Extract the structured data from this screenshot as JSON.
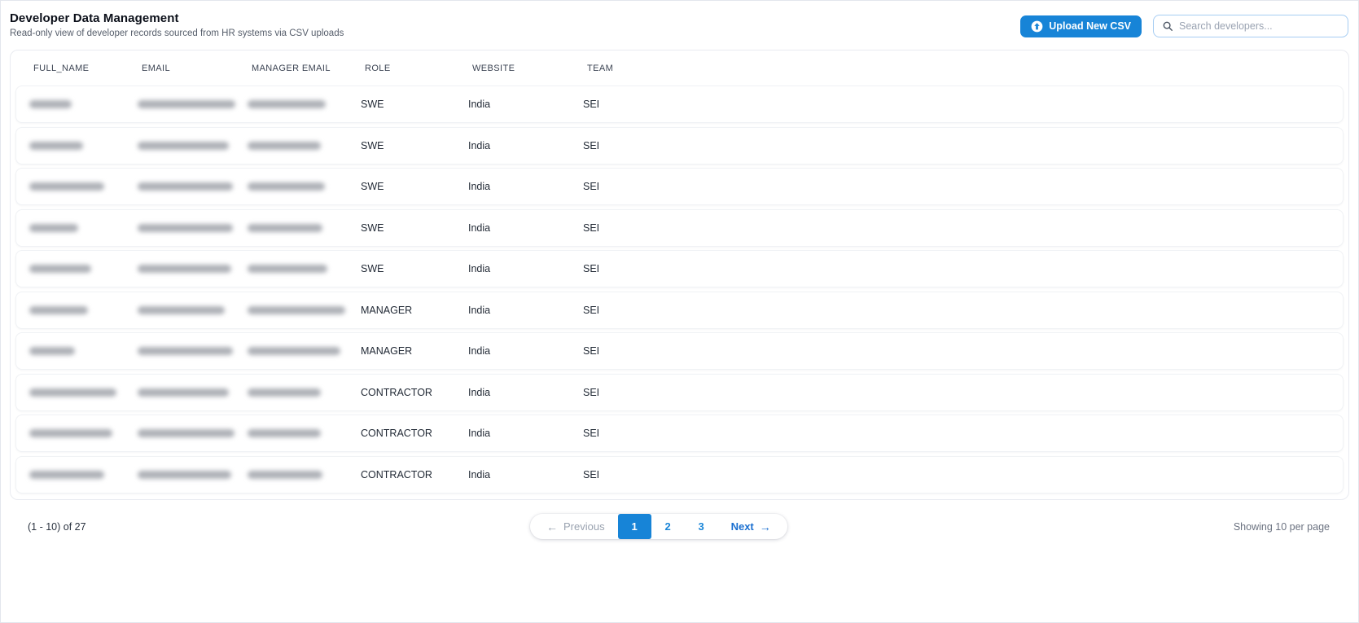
{
  "page": {
    "title": "Developer Data Management",
    "subtitle": "Read-only view of developer records sourced from HR systems via CSV uploads"
  },
  "toolbar": {
    "upload_button_label": "Upload New CSV",
    "upload_icon": "arrow-up-circle",
    "search_icon": "magnifier",
    "search_placeholder": "Search developers...",
    "search_value": ""
  },
  "colors": {
    "accent_blue": "#1784d7",
    "search_border_blue": "#a6cdf3",
    "disabled_gray": "#9aa3b0"
  },
  "table": {
    "columns": [
      "FULL_NAME",
      "EMAIL",
      "MANAGER EMAIL",
      "ROLE",
      "WEBSITE",
      "TEAM"
    ],
    "redacted_columns": [
      "FULL_NAME",
      "EMAIL",
      "MANAGER EMAIL"
    ],
    "rows": [
      {
        "full_name_redacted": true,
        "email_redacted": true,
        "manager_email_redacted": true,
        "role": "SWE",
        "website": "India",
        "team": "SEI"
      },
      {
        "full_name_redacted": true,
        "email_redacted": true,
        "manager_email_redacted": true,
        "role": "SWE",
        "website": "India",
        "team": "SEI"
      },
      {
        "full_name_redacted": true,
        "email_redacted": true,
        "manager_email_redacted": true,
        "role": "SWE",
        "website": "India",
        "team": "SEI"
      },
      {
        "full_name_redacted": true,
        "email_redacted": true,
        "manager_email_redacted": true,
        "role": "SWE",
        "website": "India",
        "team": "SEI"
      },
      {
        "full_name_redacted": true,
        "email_redacted": true,
        "manager_email_redacted": true,
        "role": "SWE",
        "website": "India",
        "team": "SEI"
      },
      {
        "full_name_redacted": true,
        "email_redacted": true,
        "manager_email_redacted": true,
        "role": "MANAGER",
        "website": "India",
        "team": "SEI"
      },
      {
        "full_name_redacted": true,
        "email_redacted": true,
        "manager_email_redacted": true,
        "role": "MANAGER",
        "website": "India",
        "team": "SEI"
      },
      {
        "full_name_redacted": true,
        "email_redacted": true,
        "manager_email_redacted": true,
        "role": "CONTRACTOR",
        "website": "India",
        "team": "SEI"
      },
      {
        "full_name_redacted": true,
        "email_redacted": true,
        "manager_email_redacted": true,
        "role": "CONTRACTOR",
        "website": "India",
        "team": "SEI"
      },
      {
        "full_name_redacted": true,
        "email_redacted": true,
        "manager_email_redacted": true,
        "role": "CONTRACTOR",
        "website": "India",
        "team": "SEI"
      }
    ]
  },
  "pagination": {
    "range_label": "(1 - 10) of 27",
    "previous_label": "Previous",
    "next_label": "Next",
    "previous_arrow": "←",
    "next_arrow": "→",
    "pages": [
      "1",
      "2",
      "3"
    ],
    "active_page": "1",
    "per_page_label": "Showing 10 per page"
  }
}
